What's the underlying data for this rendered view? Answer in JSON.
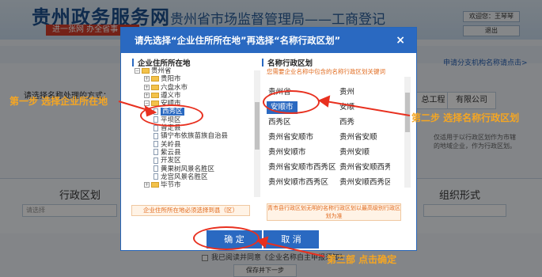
{
  "background": {
    "logo": "贵州政务服务网",
    "logo_sub": "进一张网 办全省事",
    "page_title": "贵州省市场监督管理局——工商登记",
    "btn_welcome": "欢迎您：王琴琴",
    "btn_logout": "退出",
    "link_right": "申请分支机构名称请点击>",
    "label_left": "请选择名称处理的方式：",
    "box_1": "总工程",
    "box_2": "有限公司",
    "side_text": "仅适用于以行政区划作为市辖的地域企业，作为行政区划。",
    "section_title_left": "行政区划",
    "section_title_right": "组织形式",
    "input_placeholder": "请选择",
    "bottom_text": "我已阅读并同意《企业名称自主申报须知》",
    "bottom_btn": "保存并下一步"
  },
  "dialog": {
    "title": "请先选择“企业住所所在地”再选择“名称行政区划”",
    "close": "×",
    "left_title": "企业住所所在地",
    "right_title": "名称行政区划",
    "right_note": "您需要企业名称中包含的名称行政区划关键词",
    "tree": [
      {
        "label": "贵州省",
        "level": 0,
        "expand": "⊟",
        "type": "folder"
      },
      {
        "label": "贵阳市",
        "level": 1,
        "expand": "⊞",
        "type": "folder"
      },
      {
        "label": "六盘水市",
        "level": 1,
        "expand": "⊞",
        "type": "folder"
      },
      {
        "label": "遵义市",
        "level": 1,
        "expand": "⊞",
        "type": "folder"
      },
      {
        "label": "安顺市",
        "level": 1,
        "expand": "⊟",
        "type": "folder"
      },
      {
        "label": "西秀区",
        "level": 2,
        "expand": "",
        "type": "file",
        "selected": true
      },
      {
        "label": "平坝区",
        "level": 2,
        "expand": "",
        "type": "file"
      },
      {
        "label": "普定县",
        "level": 2,
        "expand": "",
        "type": "file"
      },
      {
        "label": "镇宁布依族苗族自治县",
        "level": 2,
        "expand": "",
        "type": "file"
      },
      {
        "label": "关岭县",
        "level": 2,
        "expand": "",
        "type": "file"
      },
      {
        "label": "紫云县",
        "level": 2,
        "expand": "",
        "type": "file"
      },
      {
        "label": "开发区",
        "level": 2,
        "expand": "",
        "type": "file"
      },
      {
        "label": "黄果树风景名胜区",
        "level": 2,
        "expand": "",
        "type": "file"
      },
      {
        "label": "龙宫风景名胜区",
        "level": 2,
        "expand": "",
        "type": "file"
      },
      {
        "label": "毕节市",
        "level": 1,
        "expand": "⊞",
        "type": "folder"
      }
    ],
    "regions": [
      {
        "label": "贵州省",
        "selected": false
      },
      {
        "label": "贵州",
        "selected": false
      },
      {
        "label": "安顺市",
        "selected": true
      },
      {
        "label": "安顺",
        "selected": false
      },
      {
        "label": "西秀区",
        "selected": false
      },
      {
        "label": "西秀",
        "selected": false
      },
      {
        "label": "贵州省安顺市",
        "selected": false
      },
      {
        "label": "贵州省安顺",
        "selected": false
      },
      {
        "label": "贵州安顺市",
        "selected": false
      },
      {
        "label": "贵州安顺",
        "selected": false
      },
      {
        "label": "贵州省安顺市西秀区",
        "selected": false
      },
      {
        "label": "贵州省安顺西秀区",
        "selected": false
      },
      {
        "label": "贵州安顺市西秀区",
        "selected": false
      },
      {
        "label": "贵州安顺西秀区",
        "selected": false
      }
    ],
    "left_hint": "企业住所所在地必须选择到县（区）",
    "right_hint": "青市县行政区划无明的名称行政区划以最高级别行政区划为准",
    "confirm": "确 定",
    "cancel": "取 消"
  },
  "annotations": {
    "step1": "第一步 选择企业所在地",
    "step2": "第二步 选择名称行政区划",
    "step3": "第三部 点击确定",
    "color": "#f5a623",
    "ring_color": "#e8301f"
  }
}
